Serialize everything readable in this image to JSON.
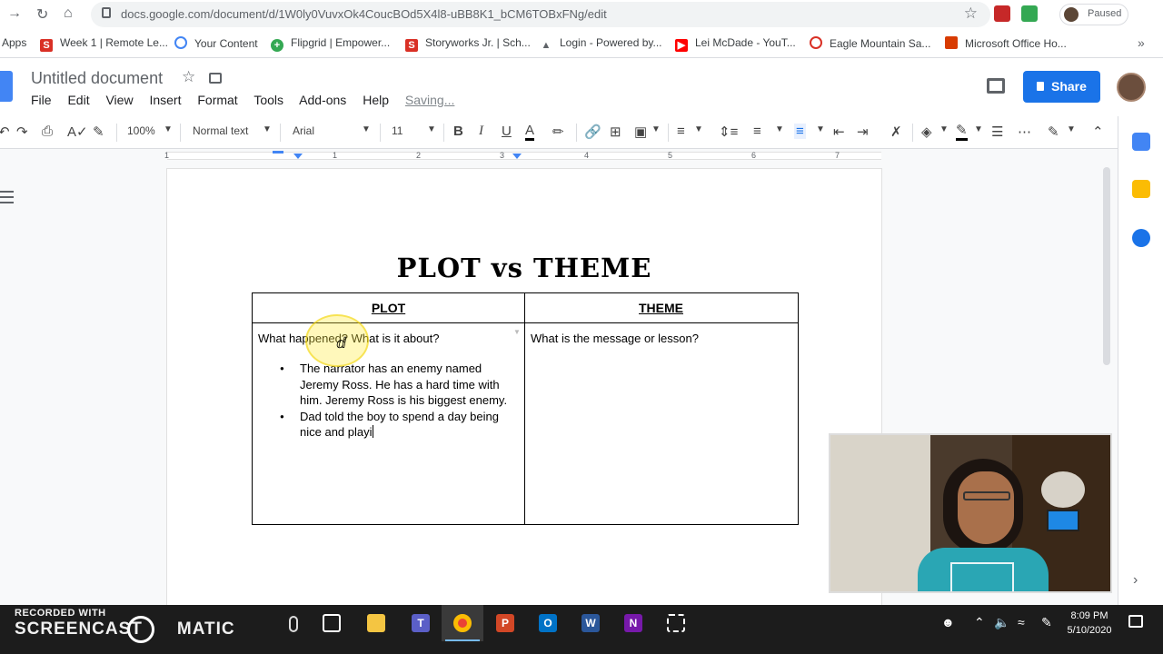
{
  "browser": {
    "url": "docs.google.com/document/d/1W0ly0VuvxOk4CoucBOd5X4l8-uBB8K1_bCM6TOBxFNg/edit",
    "profile_status": "Paused"
  },
  "bookmarks": [
    {
      "label": "Apps",
      "icon": "apps-grid-icon"
    },
    {
      "label": "Week 1 | Remote Le...",
      "icon": "s-icon",
      "color": "#d93025"
    },
    {
      "label": "Your Content",
      "icon": "content-icon",
      "color": "#4285f4"
    },
    {
      "label": "Flipgrid | Empower...",
      "icon": "flipgrid-icon",
      "color": "#34a853"
    },
    {
      "label": "Storyworks Jr. | Sch...",
      "icon": "s-icon",
      "color": "#d93025"
    },
    {
      "label": "Login - Powered by...",
      "icon": "chart-icon",
      "color": "#5f6368"
    },
    {
      "label": "Lei McDade - YouT...",
      "icon": "youtube-icon",
      "color": "#ff0000"
    },
    {
      "label": "Eagle Mountain Sa...",
      "icon": "eye-icon",
      "color": "#d93025"
    },
    {
      "label": "Microsoft Office Ho...",
      "icon": "office-icon",
      "color": "#d83b01"
    }
  ],
  "docs": {
    "title": "Untitled document",
    "menu": [
      "File",
      "Edit",
      "View",
      "Insert",
      "Format",
      "Tools",
      "Add-ons",
      "Help"
    ],
    "save_status": "Saving...",
    "share_label": "Share",
    "toolbar": {
      "zoom": "100%",
      "style": "Normal text",
      "font": "Arial",
      "font_size": "11"
    },
    "ruler_numbers": [
      "1",
      "1",
      "2",
      "3",
      "4",
      "5",
      "6",
      "7"
    ]
  },
  "document": {
    "heading": "PLOT vs THEME",
    "table": {
      "headers": [
        "PLOT",
        "THEME"
      ],
      "plot_question": "What happened?  What is it about?",
      "theme_question": "What is the message or lesson?",
      "plot_bullets": [
        "The narrator has an enemy named Jeremy Ross.  He has a hard time with him.  Jeremy Ross is his biggest enemy.",
        "Dad told the boy to spend a day being nice and playi"
      ]
    }
  },
  "taskbar": {
    "watermark_top": "RECORDED WITH",
    "watermark": "SCREENCAST",
    "watermark_end": "MATIC",
    "apps": [
      "task-view",
      "file-explorer",
      "teams",
      "chrome",
      "powerpoint",
      "outlook",
      "word",
      "onenote",
      "snipping-tool"
    ],
    "time": "8:09 PM",
    "date": "5/10/2020"
  },
  "colors": {
    "share_blue": "#1a73e8",
    "docs_blue": "#4285f4",
    "taskbar": "#1c1c1c"
  }
}
